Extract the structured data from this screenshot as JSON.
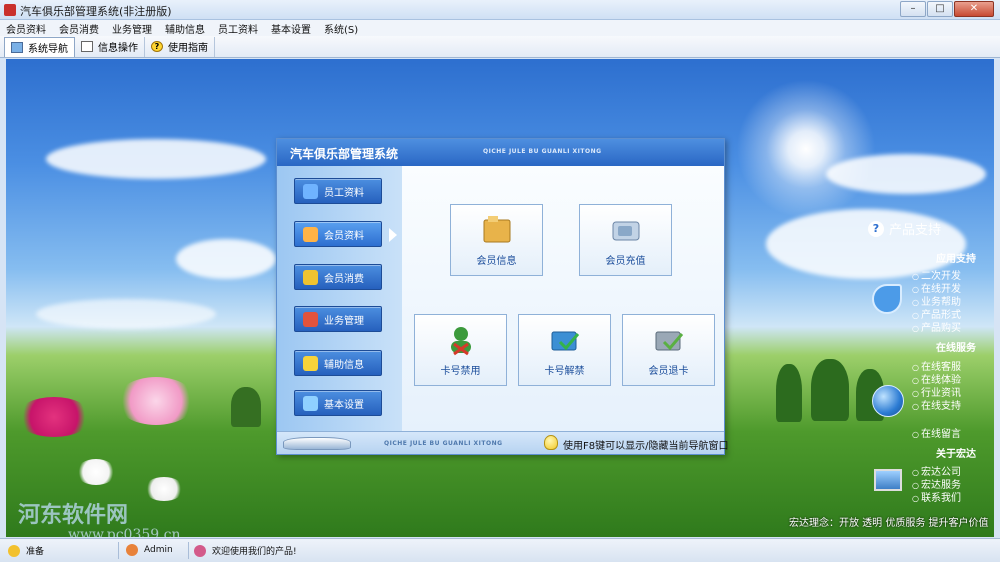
{
  "window": {
    "title": "汽车俱乐部管理系统(非注册版)",
    "min_label": "–",
    "max_label": "□",
    "close_label": "✕"
  },
  "menubar": {
    "items": [
      "会员资料",
      "会员消费",
      "业务管理",
      "辅助信息",
      "员工资料",
      "基本设置",
      "系统(S)"
    ]
  },
  "toolbar": {
    "tabs": [
      {
        "label": "系统导航",
        "icon": "monitor-icon"
      },
      {
        "label": "信息操作",
        "icon": "document-icon"
      },
      {
        "label": "使用指南",
        "icon": "help-icon"
      }
    ],
    "help_glyph": "?"
  },
  "dialog": {
    "title": "汽车俱乐部管理系统",
    "subtitle": "QICHE JULE BU GUANLI XITONG",
    "nav": [
      {
        "label": "员工资料",
        "icon": "staff-card-icon",
        "color": "#6fb3ff"
      },
      {
        "label": "会员资料",
        "icon": "member-icon",
        "color": "#ffb347"
      },
      {
        "label": "会员消费",
        "icon": "coins-icon",
        "color": "#f0c330"
      },
      {
        "label": "业务管理",
        "icon": "monitor-icon",
        "color": "#e2533c"
      },
      {
        "label": "辅助信息",
        "icon": "star-icon",
        "color": "#f7d33a"
      },
      {
        "label": "基本设置",
        "icon": "settings-icon",
        "color": "#8fd0ff"
      }
    ],
    "tiles": [
      {
        "label": "会员信息",
        "icon": "folder-icon",
        "color": "#e8b34a"
      },
      {
        "label": "会员充值",
        "icon": "card-reader-icon",
        "color": "#8aa8c8"
      },
      {
        "label": "卡号禁用",
        "icon": "user-block-icon",
        "color": "#3c9a3c"
      },
      {
        "label": "卡号解禁",
        "icon": "card-check-icon",
        "color": "#3c8fd4"
      },
      {
        "label": "会员退卡",
        "icon": "card-return-icon",
        "color": "#5ab043"
      }
    ],
    "footer_subtitle": "QICHE JULE BU GUANLI XITONG",
    "footer_hint": "使用F8键可以显示/隐藏当前导航窗口"
  },
  "support": {
    "title": "产品支持",
    "help_glyph": "?",
    "sections": [
      {
        "title": "应用支持",
        "links": [
          "二次开发",
          "在线开发",
          "业务帮助",
          "产品形式",
          "产品购买"
        ]
      },
      {
        "title": "在线服务",
        "links": [
          "在线客服",
          "在线体验",
          "行业资讯",
          "在线支持",
          "在线留言"
        ]
      },
      {
        "title": "关于宏达",
        "links": [
          "宏达公司",
          "宏达服务",
          "联系我们"
        ]
      }
    ],
    "slogan": "宏达理念：开放 透明 优质服务 提升客户价值"
  },
  "watermark": {
    "text": "河东软件网",
    "url": "www.pc0359.cn"
  },
  "statusbar": {
    "status": "准备",
    "user": "Admin",
    "message": "欢迎使用我们的产品!"
  },
  "colors": {
    "accent": "#2a67c4",
    "sky": "#4b8fe3",
    "grass": "#4e9a2c"
  }
}
